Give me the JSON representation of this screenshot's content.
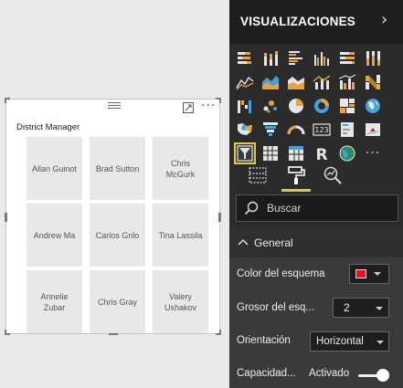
{
  "slicer": {
    "title": "District Manager",
    "items": [
      "Allan Guinot",
      "Brad Sutton",
      "Chris McGurk",
      "Andrew Ma",
      "Carlos Grilo",
      "Tina Lassila",
      "Annelie Zubar",
      "Chris Gray",
      "Valery Ushakov"
    ]
  },
  "pane": {
    "title": "VISUALIZACIONES",
    "visual_icons": [
      "stacked-bar-chart-icon",
      "stacked-column-chart-icon",
      "clustered-bar-chart-icon",
      "clustered-column-chart-icon",
      "100-percent-stacked-bar-chart-icon",
      "100-percent-stacked-column-chart-icon",
      "line-chart-icon",
      "area-chart-icon",
      "stacked-area-chart-icon",
      "line-and-stacked-column-chart-icon",
      "line-and-clustered-column-chart-icon",
      "ribbon-chart-icon",
      "waterfall-chart-icon",
      "scatter-chart-icon",
      "pie-chart-icon",
      "donut-chart-icon",
      "treemap-icon",
      "map-icon",
      "filled-map-icon",
      "funnel-icon",
      "gauge-icon",
      "card-icon",
      "multi-row-card-icon",
      "kpi-icon",
      "slicer-icon",
      "table-icon",
      "matrix-icon",
      "r-script-visual-icon",
      "globe-visual-icon",
      "more-visuals-icon"
    ],
    "selected_icon": "slicer-icon",
    "more_label": "···",
    "search_placeholder": "Buscar",
    "section_title": "General",
    "rows": {
      "outline_color_label": "Color del esquema",
      "outline_color": "#e81123",
      "outline_weight_label": "Grosor del esq...",
      "outline_weight_value": "2",
      "orientation_label": "Orientación",
      "orientation_value": "Horizontal",
      "responsive_label": "Capacidad...",
      "responsive_value": "Activado"
    }
  },
  "colors": {
    "accent": "#e4c840",
    "pane_bg": "#2b2b2b",
    "tile_bg": "#e8e8e8"
  }
}
